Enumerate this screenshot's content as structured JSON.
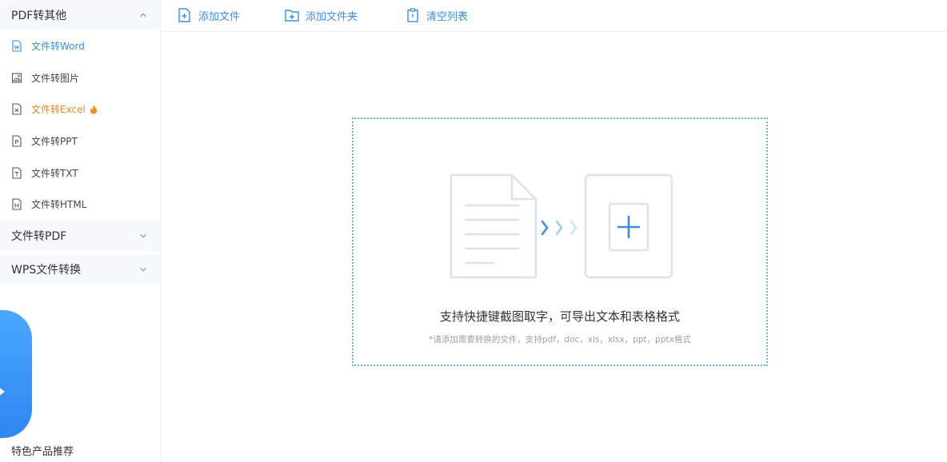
{
  "sidebar": {
    "group1": {
      "title": "PDF转其他",
      "items": [
        {
          "label": "文件转Word",
          "state": "active"
        },
        {
          "label": "文件转图片",
          "state": "normal"
        },
        {
          "label": "文件转Excel",
          "state": "hot"
        },
        {
          "label": "文件转PPT",
          "state": "normal"
        },
        {
          "label": "文件转TXT",
          "state": "normal"
        },
        {
          "label": "文件转HTML",
          "state": "normal"
        }
      ]
    },
    "group2": {
      "title": "文件转PDF"
    },
    "group3": {
      "title": "WPS文件转换"
    },
    "promo_label": "特色产品推荐"
  },
  "toolbar": {
    "add_file": "添加文件",
    "add_folder": "添加文件夹",
    "clear_list": "清空列表"
  },
  "dropzone": {
    "main_text": "支持快捷键截图取字，可导出文本和表格格式",
    "sub_text": "*请添加需要转换的文件，支持pdf，doc，xls，xlsx，ppt，pptx格式"
  },
  "colors": {
    "accent": "#3a8ee6",
    "hot": "#e8892f",
    "sidebar_header_bg": "#f5f8fc",
    "dropzone_border": "#6aaef0"
  }
}
